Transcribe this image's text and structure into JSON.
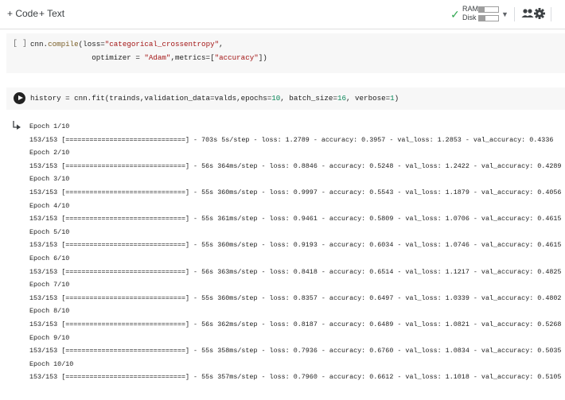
{
  "toolbar": {
    "add_code": "+ Code",
    "add_text": "+ Text",
    "ram_label": "RAM",
    "disk_label": "Disk",
    "ram_fraction": 0.3,
    "disk_fraction": 0.35
  },
  "icons": {
    "connected": "check-icon",
    "resources_menu": "caret-down-icon",
    "share": "people-icon",
    "settings": "gear-icon",
    "run": "play-icon",
    "output": "output-arrow-icon"
  },
  "colors": {
    "string": "#a31515",
    "number": "#098658",
    "function": "#795e26",
    "check": "#34a853"
  },
  "cell1": {
    "bracket": "[ ]",
    "line1": {
      "a": "cnn.",
      "fn": "compile",
      "b": "(loss=",
      "str": "\"categorical_crossentropy\"",
      "c": ","
    },
    "line2": {
      "a": "              optimizer = ",
      "str1": "\"Adam\"",
      "b": ",metrics=[",
      "str2": "\"accuracy\"",
      "c": "])"
    }
  },
  "cell2": {
    "a": "history = cnn.fit(trainds,validation_data=valds,epochs=",
    "n1": "10",
    "b": ", batch_size=",
    "n2": "16",
    "c": ", verbose=",
    "n3": "1",
    "d": ")"
  },
  "output": [
    "Epoch 1/10",
    "153/153 [==============================] - 703s 5s/step - loss: 1.2789 - accuracy: 0.3957 - val_loss: 1.2853 - val_accuracy: 0.4336",
    "Epoch 2/10",
    "153/153 [==============================] - 56s 364ms/step - loss: 0.8846 - accuracy: 0.5248 - val_loss: 1.2422 - val_accuracy: 0.4289",
    "Epoch 3/10",
    "153/153 [==============================] - 55s 360ms/step - loss: 0.9997 - accuracy: 0.5543 - val_loss: 1.1879 - val_accuracy: 0.4056",
    "Epoch 4/10",
    "153/153 [==============================] - 55s 361ms/step - loss: 0.9461 - accuracy: 0.5809 - val_loss: 1.0706 - val_accuracy: 0.4615",
    "Epoch 5/10",
    "153/153 [==============================] - 55s 360ms/step - loss: 0.9193 - accuracy: 0.6034 - val_loss: 1.0746 - val_accuracy: 0.4615",
    "Epoch 6/10",
    "153/153 [==============================] - 56s 363ms/step - loss: 0.8418 - accuracy: 0.6514 - val_loss: 1.1217 - val_accuracy: 0.4825",
    "Epoch 7/10",
    "153/153 [==============================] - 55s 360ms/step - loss: 0.8357 - accuracy: 0.6497 - val_loss: 1.0339 - val_accuracy: 0.4802",
    "Epoch 8/10",
    "153/153 [==============================] - 56s 362ms/step - loss: 0.8187 - accuracy: 0.6489 - val_loss: 1.0821 - val_accuracy: 0.5268",
    "Epoch 9/10",
    "153/153 [==============================] - 55s 358ms/step - loss: 0.7936 - accuracy: 0.6760 - val_loss: 1.0834 - val_accuracy: 0.5035",
    "Epoch 10/10",
    "153/153 [==============================] - 55s 357ms/step - loss: 0.7960 - accuracy: 0.6612 - val_loss: 1.1018 - val_accuracy: 0.5105"
  ]
}
